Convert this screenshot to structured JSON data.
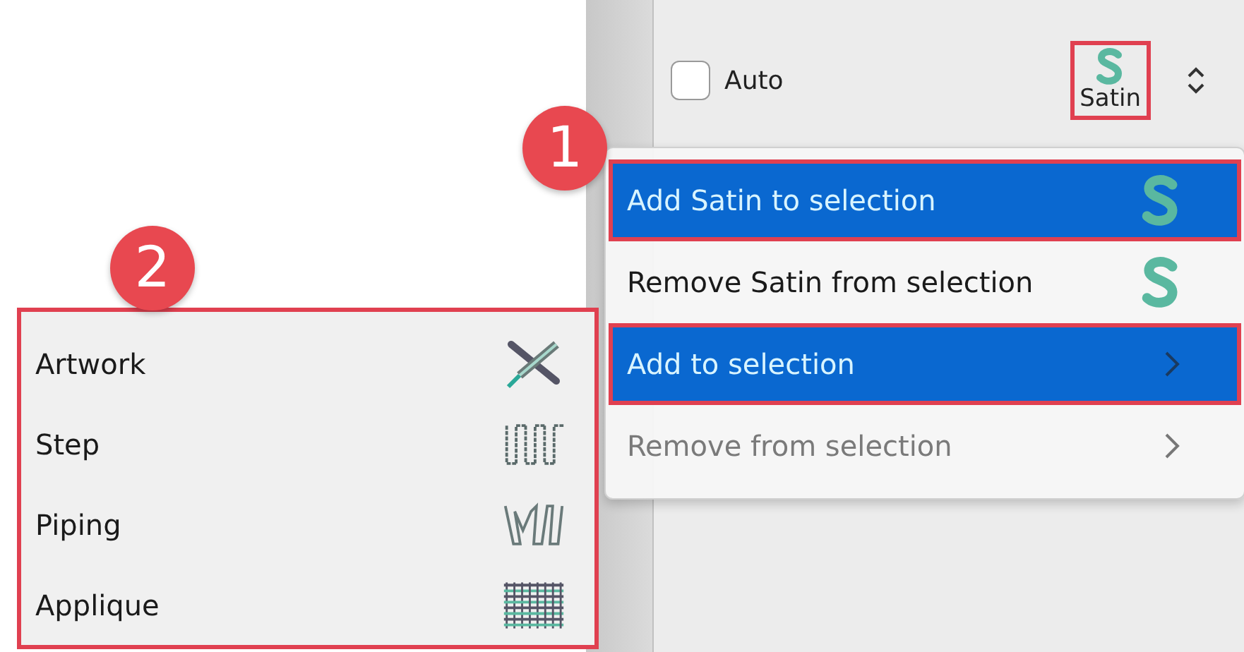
{
  "properties_panel": {
    "auto": {
      "label": "Auto",
      "checked": false
    },
    "stitch_type": {
      "label": "Satin",
      "highlighted": true
    }
  },
  "context_menu": {
    "items": [
      {
        "label": "Add Satin to selection",
        "selected": true,
        "disabled": false,
        "highlighted": true,
        "kind": "satin"
      },
      {
        "label": "Remove Satin from selection",
        "selected": false,
        "disabled": false,
        "highlighted": false,
        "kind": "satin"
      },
      {
        "label": "Add to selection",
        "selected": true,
        "disabled": false,
        "highlighted": true,
        "kind": "submenu"
      },
      {
        "label": "Remove from selection",
        "selected": false,
        "disabled": true,
        "highlighted": false,
        "kind": "submenu"
      }
    ]
  },
  "submenu": {
    "highlighted": true,
    "items": [
      {
        "label": "Artwork",
        "kind": "artwork"
      },
      {
        "label": "Step",
        "kind": "step"
      },
      {
        "label": "Piping",
        "kind": "piping"
      },
      {
        "label": "Applique",
        "kind": "applique"
      }
    ]
  },
  "callouts": [
    "1",
    "2"
  ]
}
